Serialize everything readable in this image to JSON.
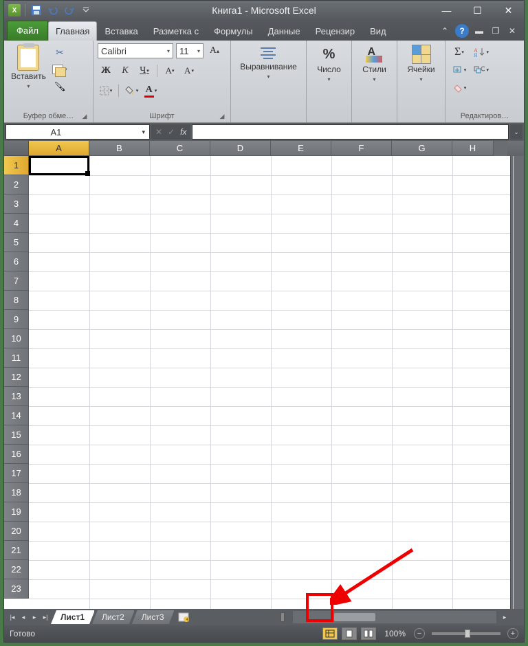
{
  "title": "Книга1 - Microsoft Excel",
  "tabs": {
    "file": "Файл",
    "items": [
      "Главная",
      "Вставка",
      "Разметка с",
      "Формулы",
      "Данные",
      "Рецензир",
      "Вид"
    ],
    "active": 0
  },
  "ribbon": {
    "clipboard": {
      "paste": "Вставить",
      "label": "Буфер обме…"
    },
    "font": {
      "name": "Calibri",
      "size": "11",
      "bold": "Ж",
      "italic": "К",
      "underline": "Ч",
      "label": "Шрифт"
    },
    "alignment": {
      "btn": "Выравнивание"
    },
    "number": {
      "btn": "Число"
    },
    "styles": {
      "btn": "Стили"
    },
    "cells": {
      "btn": "Ячейки"
    },
    "editing": {
      "label": "Редактиров…"
    }
  },
  "namebox": "A1",
  "fx": "fx",
  "columns": [
    "A",
    "B",
    "C",
    "D",
    "E",
    "F",
    "G",
    "H"
  ],
  "rows": [
    "1",
    "2",
    "3",
    "4",
    "5",
    "6",
    "7",
    "8",
    "9",
    "10",
    "11",
    "12",
    "13",
    "14",
    "15",
    "16",
    "17",
    "18",
    "19",
    "20",
    "21",
    "22",
    "23"
  ],
  "sheets": {
    "items": [
      "Лист1",
      "Лист2",
      "Лист3"
    ],
    "active": 0
  },
  "status": {
    "ready": "Готово",
    "zoom": "100%"
  }
}
